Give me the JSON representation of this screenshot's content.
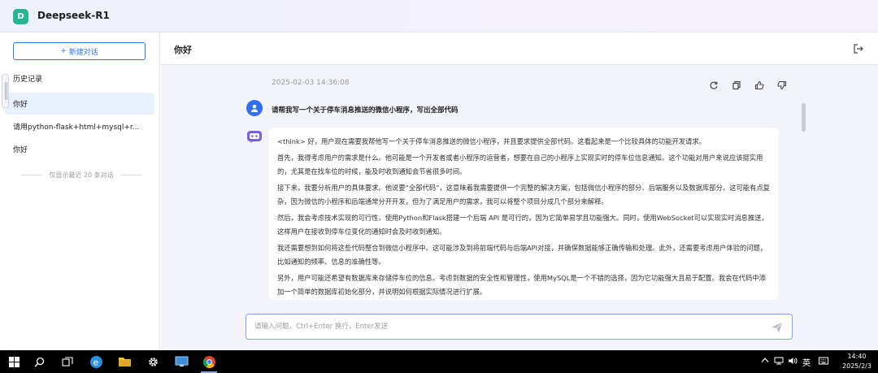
{
  "app": {
    "logo_letter": "D",
    "title": "Deepseek-R1"
  },
  "sidebar": {
    "new_chat_label": "新建对话",
    "new_chat_icon": "+",
    "history_title": "历史记录",
    "items": [
      {
        "label": "你好",
        "active": true
      },
      {
        "label": "请用python-flask+html+mysql+r...",
        "active": false
      },
      {
        "label": "你好",
        "active": false
      }
    ],
    "note": "仅显示最近 20 条对话"
  },
  "chat": {
    "title": "你好",
    "timestamp": "2025-02-03 14:36:08",
    "user_message": "请帮我写一个关于停车消息推送的微信小程序，写出全部代码",
    "answer_paragraphs": [
      "<think> 好，用户现在需要我帮他写一个关于停车消息推送的微信小程序，并且要求提供全部代码。这看起来是一个比较具体的功能开发请求。",
      "首先，我得考虑用户的需求是什么。他可能是一个开发者或者小程序的运营者，想要在自己的小程序上实现实时的停车位信息通知。这个功能对用户来说应该挺实用的，尤其是在找车位的时候，能及时收到通知会节省很多时间。",
      "接下来，我要分析用户的具体要求。他说要“全部代码”，这意味着我需要提供一个完整的解决方案，包括微信小程序的部分、后端服务以及数据库部分。这可能有点复杂，因为微信的小程序和后端通常分开开发，但为了满足用户的需求，我可以将整个项目分成几个部分来解释。",
      "然后，我会考虑技术实现的可行性。使用Python和Flask搭建一个后端 API 是可行的，因为它简单易学且功能强大。同时，使用WebSocket可以实现实时消息推送，这样用户在接收到停车位变化的通知时会及时收到通知。",
      "我还需要想到如何将这些代码整合到微信小程序中。这可能涉及到将前端代码与后端API对接，并确保数据能够正确传输和处理。此外，还需要考虑用户体验的问题，比如通知的频率、信息的准确性等。",
      "另外，用户可能还希望有数据库来存储停车位的信息。考虑到数据的安全性和管理性，使用MySQL是一个不错的选择，因为它功能强大且易于配置。我会在代码中添加一个简单的数据库初始化部分，并说明如何根据实际情况进行扩展。"
    ],
    "input_placeholder": "请输入问题，Ctrl+Enter 换行，Enter发送"
  },
  "taskbar": {
    "ime_label": "英",
    "time": "14:40",
    "date": "2025/2/3"
  },
  "colors": {
    "accent": "#2f74f5",
    "logo": "#25b58f",
    "chat_bg": "#f2f4f9"
  }
}
